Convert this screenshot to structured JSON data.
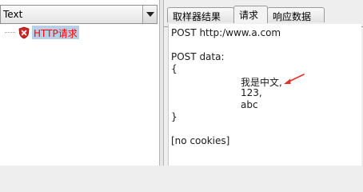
{
  "left": {
    "combo_text": "Text",
    "tree_root_label": "HTTP请求"
  },
  "tabs": [
    {
      "label": "取样器结果"
    },
    {
      "label": "请求"
    },
    {
      "label": "响应数据"
    }
  ],
  "request": {
    "line1": "POST http:/www.a.com",
    "line2": "POST data:",
    "line3": "{",
    "line4": "我是中文,",
    "line5": "123,",
    "line6": "abc",
    "line7": "}",
    "line8": "[no cookies]"
  },
  "colors": {
    "selection_bg": "#b8cfe5",
    "label_red": "#ff0000",
    "annotation_arrow": "#e0312e"
  },
  "icons": {
    "node_icon": "shield-x-icon",
    "dropdown": "chevron-down-icon",
    "annotation": "arrow-icon"
  }
}
